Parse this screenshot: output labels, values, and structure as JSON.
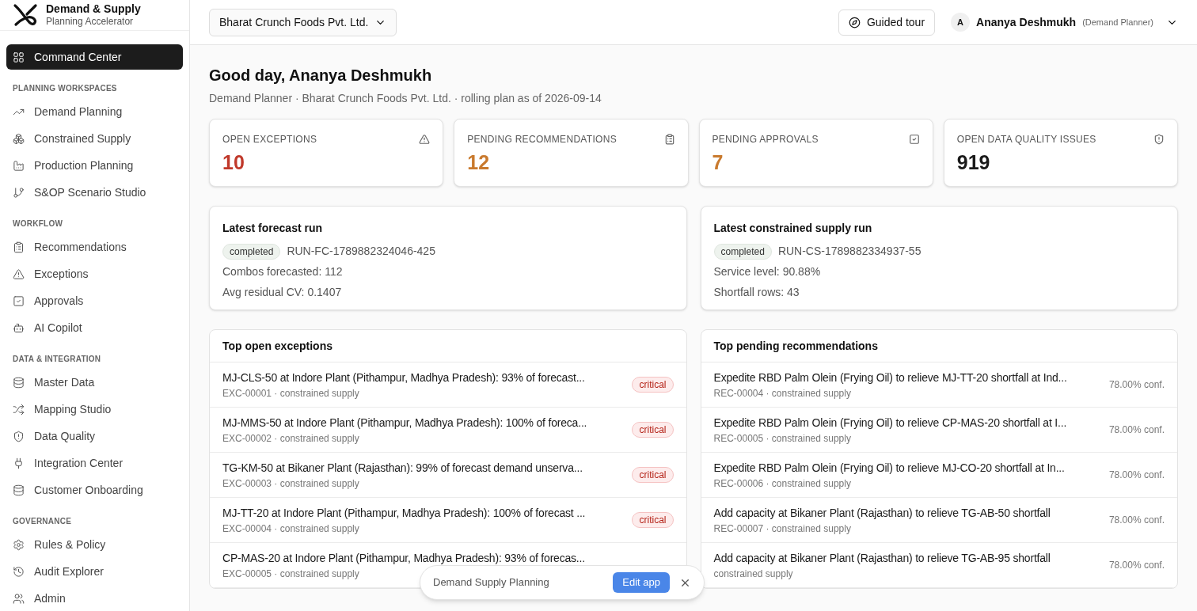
{
  "brand": {
    "title": "Demand & Supply",
    "subtitle": "Planning Accelerator"
  },
  "sidebar": {
    "sections": [
      {
        "items": [
          {
            "label": "Command Center",
            "selected": true
          }
        ]
      },
      {
        "label": "PLANNING WORKSPACES",
        "items": [
          {
            "label": "Demand Planning",
            "selected": false
          },
          {
            "label": "Constrained Supply",
            "selected": false
          },
          {
            "label": "Production Planning",
            "selected": false
          },
          {
            "label": "S&OP Scenario Studio",
            "selected": false
          }
        ]
      },
      {
        "label": "WORKFLOW",
        "items": [
          {
            "label": "Recommendations",
            "selected": false
          },
          {
            "label": "Exceptions",
            "selected": false
          },
          {
            "label": "Approvals",
            "selected": false
          },
          {
            "label": "AI Copilot",
            "selected": false
          }
        ]
      },
      {
        "label": "DATA & INTEGRATION",
        "items": [
          {
            "label": "Master Data",
            "selected": false
          },
          {
            "label": "Mapping Studio",
            "selected": false
          },
          {
            "label": "Data Quality",
            "selected": false
          },
          {
            "label": "Integration Center",
            "selected": false
          },
          {
            "label": "Customer Onboarding",
            "selected": false
          }
        ]
      },
      {
        "label": "GOVERNANCE",
        "items": [
          {
            "label": "Rules & Policy",
            "selected": false
          },
          {
            "label": "Audit Explorer",
            "selected": false
          },
          {
            "label": "Admin",
            "selected": false
          }
        ]
      }
    ]
  },
  "header": {
    "company": "Bharat Crunch Foods Pvt. Ltd.",
    "tour": "Guided tour",
    "avatar": "A",
    "user": "Ananya Deshmukh",
    "role": "(Demand Planner)"
  },
  "greeting": {
    "title": "Good day, Ananya Deshmukh",
    "subtitle": "Demand Planner · Bharat Crunch Foods Pvt. Ltd. · rolling plan as of 2026-09-14"
  },
  "stats": [
    {
      "label": "OPEN EXCEPTIONS",
      "value": "10",
      "color": "#c0392b"
    },
    {
      "label": "PENDING RECOMMENDATIONS",
      "value": "12",
      "color": "#c97a2e"
    },
    {
      "label": "PENDING APPROVALS",
      "value": "7",
      "color": "#c97a2e"
    },
    {
      "label": "OPEN DATA QUALITY ISSUES",
      "value": "919",
      "color": "#1a1a1a"
    }
  ],
  "runs": [
    {
      "title": "Latest forecast run",
      "status": "completed",
      "run_id": "RUN-FC-1789882324046-425",
      "lines": [
        "Combos forecasted: 112",
        "Avg residual CV: 0.1407"
      ]
    },
    {
      "title": "Latest constrained supply run",
      "status": "completed",
      "run_id": "RUN-CS-1789882334937-55",
      "lines": [
        "Service level: 90.88%",
        "Shortfall rows: 43"
      ]
    }
  ],
  "exceptions": {
    "title": "Top open exceptions",
    "rows": [
      {
        "text": "MJ-CLS-50 at Indore Plant (Pithampur, Madhya Pradesh): 93% of forecast...",
        "meta": "EXC-00001 · constrained supply",
        "severity": "critical"
      },
      {
        "text": "MJ-MMS-50 at Indore Plant (Pithampur, Madhya Pradesh): 100% of foreca...",
        "meta": "EXC-00002 · constrained supply",
        "severity": "critical"
      },
      {
        "text": "TG-KM-50 at Bikaner Plant (Rajasthan): 99% of forecast demand unserva...",
        "meta": "EXC-00003 · constrained supply",
        "severity": "critical"
      },
      {
        "text": "MJ-TT-20 at Indore Plant (Pithampur, Madhya Pradesh): 100% of forecast ...",
        "meta": "EXC-00004 · constrained supply",
        "severity": "critical"
      },
      {
        "text": "CP-MAS-20 at Indore Plant (Pithampur, Madhya Pradesh): 93% of forecas...",
        "meta": "EXC-00005 · constrained supply"
      }
    ]
  },
  "recommendations": {
    "title": "Top pending recommendations",
    "rows": [
      {
        "text": "Expedite RBD Palm Olein (Frying Oil) to relieve MJ-TT-20 shortfall at Ind...",
        "meta": "REC-00004 · constrained supply",
        "conf": "78.00% conf."
      },
      {
        "text": "Expedite RBD Palm Olein (Frying Oil) to relieve CP-MAS-20 shortfall at I...",
        "meta": "REC-00005 · constrained supply",
        "conf": "78.00% conf."
      },
      {
        "text": "Expedite RBD Palm Olein (Frying Oil) to relieve MJ-CO-20 shortfall at In...",
        "meta": "REC-00006 · constrained supply",
        "conf": "78.00% conf."
      },
      {
        "text": "Add capacity at Bikaner Plant (Rajasthan) to relieve TG-AB-50 shortfall",
        "meta": "REC-00007 · constrained supply",
        "conf": "78.00% conf."
      },
      {
        "text": "Add capacity at Bikaner Plant (Rajasthan) to relieve TG-AB-95 shortfall",
        "meta": "constrained supply",
        "conf": "78.00% conf."
      }
    ]
  },
  "floating_bar": {
    "label": "Demand Supply Planning",
    "button": "Edit app"
  }
}
